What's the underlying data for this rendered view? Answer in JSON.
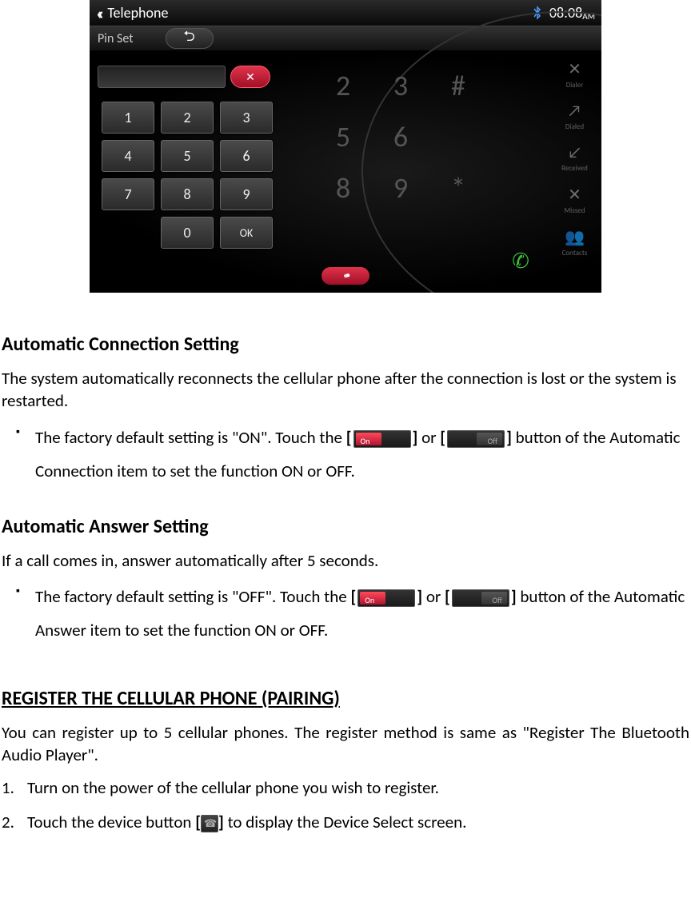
{
  "screenshot": {
    "status_chevrons": "‹‹‹",
    "title": "Telephone",
    "time": "08:08",
    "time_suffix": "AM",
    "pinset_label": "Pin Set",
    "back_glyph": "⮌",
    "clear_glyph": "✕",
    "bg_keys": [
      [
        "2",
        "3",
        "#"
      ],
      [
        "5",
        "6",
        ""
      ],
      [
        "8",
        "9",
        "*"
      ]
    ],
    "pin_keys": [
      [
        "1",
        "2",
        "3"
      ],
      [
        "4",
        "5",
        "6"
      ],
      [
        "7",
        "8",
        "9"
      ],
      [
        "",
        "0",
        "OK"
      ]
    ],
    "right_menu": [
      "Dialer",
      "Dialed",
      "Received",
      "Missed",
      "Contacts"
    ],
    "right_glyphs": [
      "✕",
      "↗",
      "↙",
      "✕",
      "👥"
    ],
    "call_glyph": "✆",
    "bottom_glyph": "‹‹‹•"
  },
  "sections": {
    "auto_conn": {
      "heading": "Automatic Connection Setting",
      "intro": "The system automatically reconnects the cellular phone after the connection is lost or the system is restarted.",
      "b1_pre": "The factory default setting is \"ON\". Touch the ",
      "b1_or": " or ",
      "b1_post": " button of the Automatic Connection item to set the function ON or OFF."
    },
    "auto_ans": {
      "heading": "Automatic Answer Setting",
      "intro": "If a call comes in, answer automatically after 5 seconds.",
      "b1_pre": "The factory default setting is \"OFF\". Touch the ",
      "b1_or": " or ",
      "b1_post": " button of the Automatic Answer item to set the function ON or OFF."
    },
    "register": {
      "heading": "REGISTER THE CELLULAR PHONE (PAIRING)",
      "intro": "You can register up to 5 cellular phones. The register method is same as \"Register The Bluetooth Audio Player\".",
      "step1_num": "1.",
      "step1": "Turn on the power of the cellular phone you wish to register.",
      "step2_num": "2.",
      "step2_pre": "Touch the device button ",
      "step2_post": " to display the Device Select screen."
    }
  },
  "brackets": {
    "open": "[",
    "close": "]"
  },
  "bullet_marker": "▪"
}
